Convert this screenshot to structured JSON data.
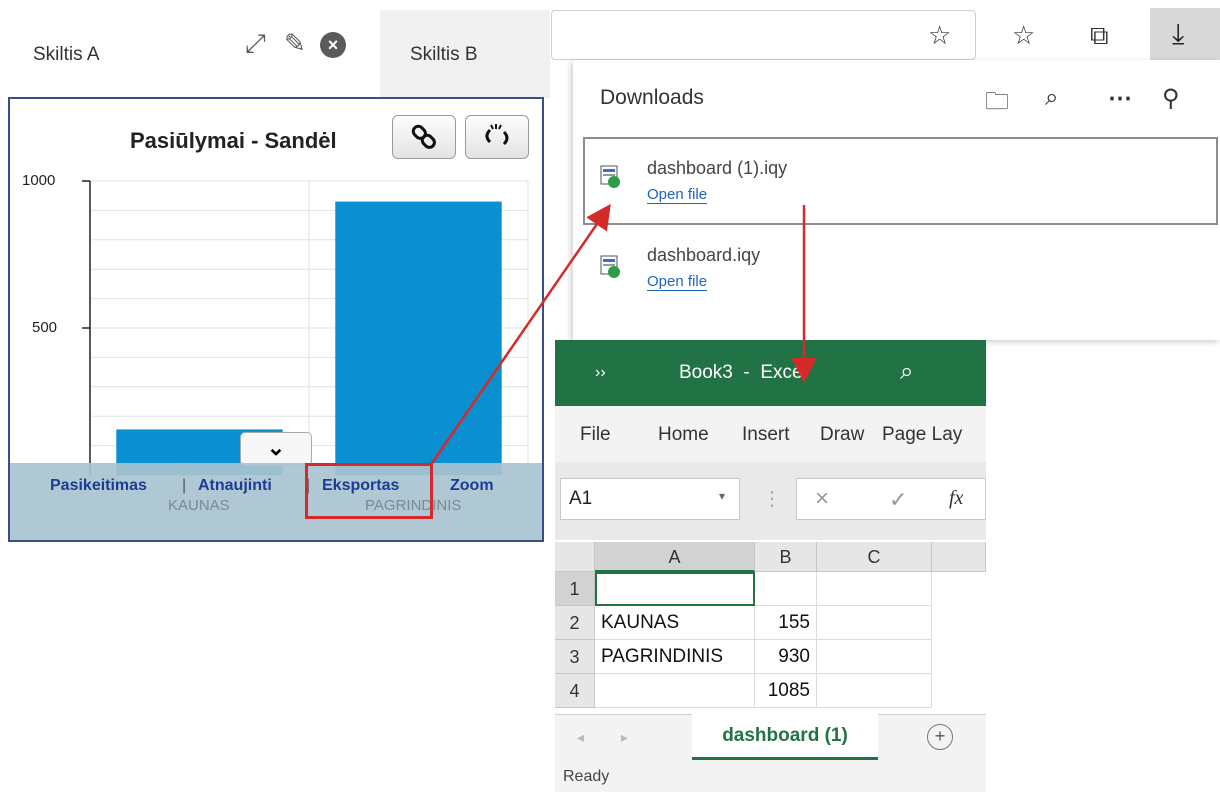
{
  "dashboard": {
    "tab_a": {
      "label": "Skiltis A"
    },
    "tab_b": {
      "label": "Skiltis B"
    },
    "footer_links": [
      "Pasikeitimas",
      "Atnaujinti",
      "Eksportas",
      "Zoom"
    ],
    "footer_sep": "|"
  },
  "chart_data": {
    "type": "bar",
    "title": "Pasiūlymai - Sandėl",
    "categories": [
      "KAUNAS",
      "PAGRINDINIS"
    ],
    "values": [
      155,
      930
    ],
    "ylim": [
      0,
      1000
    ],
    "yticks": [
      "1000",
      "500"
    ],
    "grid": true,
    "bar_color": "#0a8fd0"
  },
  "downloads": {
    "title": "Downloads",
    "items": [
      {
        "name": "dashboard (1).iqy",
        "action": "Open file"
      },
      {
        "name": "dashboard.iqy",
        "action": "Open file"
      }
    ]
  },
  "excel": {
    "title": "Book3  -  Excel",
    "chevrons": "››",
    "ribbon_tabs": [
      "File",
      "Home",
      "Insert",
      "Draw",
      "Page Lay"
    ],
    "name_box": "A1",
    "fx": "fx",
    "columns": [
      "A",
      "B",
      "C"
    ],
    "rows": [
      {
        "num": "1",
        "a": "",
        "b": ""
      },
      {
        "num": "2",
        "a": "KAUNAS",
        "b": "155"
      },
      {
        "num": "3",
        "a": "PAGRINDINIS",
        "b": "930"
      },
      {
        "num": "4",
        "a": "",
        "b": "1085"
      }
    ],
    "sheet_tab": "dashboard (1)",
    "status": "Ready"
  },
  "colors": {
    "excel_green": "#217346",
    "annotation_red": "#d42a2a",
    "link_blue": "#1e3c96"
  }
}
